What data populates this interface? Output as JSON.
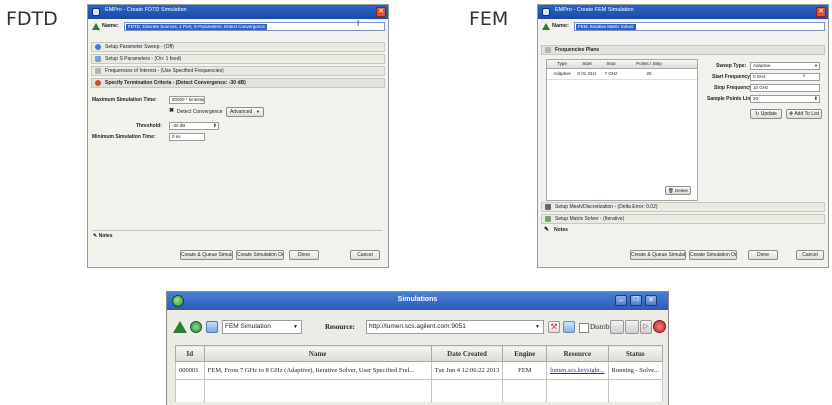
{
  "labels": {
    "fdtd": "FDTD",
    "fem": "FEM"
  },
  "colors": {
    "titlebar": "#1f52b0",
    "selection": "#3163c5",
    "green": "#2f7d33",
    "red": "#d64a33",
    "link": "#2233aa"
  },
  "fdtd": {
    "title": "EMPro - Create FDTD Simulation",
    "name_label": "Name:",
    "name_value": "FDTD, Discrete Sources, 1 Port, S-Parameters, Detect Convergence",
    "sections": [
      "Setup Parameter Sweep - (Off)",
      "Setup S Parameters - (On: 1 feed)",
      "Frequencies of Interest - (Use Specified Frequencies)"
    ],
    "termination_title": "Specify Termination Criteria - (Detect Convergence: -30 dB)",
    "max_sim_label": "Maximum Simulation Time:",
    "max_sim_value": "50000 * timestep",
    "detect_label": "Detect Convergence",
    "advanced_label": "Advanced",
    "threshold_label": "Threshold:",
    "threshold_value": "-30 dB",
    "min_sim_label": "Minimum Simulation Time:",
    "min_sim_value": "0 ns",
    "notes_label": "Notes",
    "buttons": {
      "create_queue": "Create & Queue Simulation",
      "create_only": "Create Simulation Only",
      "done": "Done",
      "cancel": "Cancel"
    }
  },
  "fem": {
    "title": "EMPro - Create FEM Simulation",
    "name_label": "Name:",
    "name_value": "FEM, Iterative Matrix Solver",
    "freq_plans_title": "Frequencies Plans",
    "table_headers": [
      "Type",
      "Start",
      "Stop",
      "Points / Step"
    ],
    "table_row": [
      "Adaptive",
      "0.01 GHz",
      "7 GHz",
      "20"
    ],
    "sweep_type_label": "Sweep Type:",
    "sweep_type_value": "Adaptive",
    "start_freq_label": "Start Frequency:",
    "start_freq_value": "0 GHz",
    "stop_freq_label": "Stop Frequency:",
    "stop_freq_value": "10 GHz",
    "sample_points_label": "Sample Points Limit:",
    "sample_points_value": "20",
    "update_label": "Update",
    "add_to_list_label": "Add To List",
    "delete_label": "Delete",
    "sections": [
      "Setup Mesh/Discretization - (Delta Error: 0.02)",
      "Setup Matrix Solver - (Iterative)",
      "Notes"
    ],
    "buttons": {
      "create_queue": "Create & Queue Simulation",
      "create_only": "Create Simulation Only",
      "done": "Done",
      "cancel": "Cancel"
    }
  },
  "simulations": {
    "title": "Simulations",
    "combo_value": "FEM Simulation",
    "resource_label": "Resource:",
    "resource_value": "http://lumen.scs.agilent.com:9051",
    "distributed_label": "Distributed",
    "columns": [
      "Id",
      "Name",
      "Date Created",
      "Engine",
      "Resource",
      "Status"
    ],
    "rows": [
      {
        "id": "000001",
        "name": "FEM, From 7 GHz to 8 GHz (Adaptive), Iterative Solver, User Specified Frel...",
        "date": "Tue Jun 4 12:06:22 2013",
        "engine": "FEM",
        "resource": "lumen.scs.keysight...",
        "status": "Running - Solve..."
      }
    ]
  }
}
